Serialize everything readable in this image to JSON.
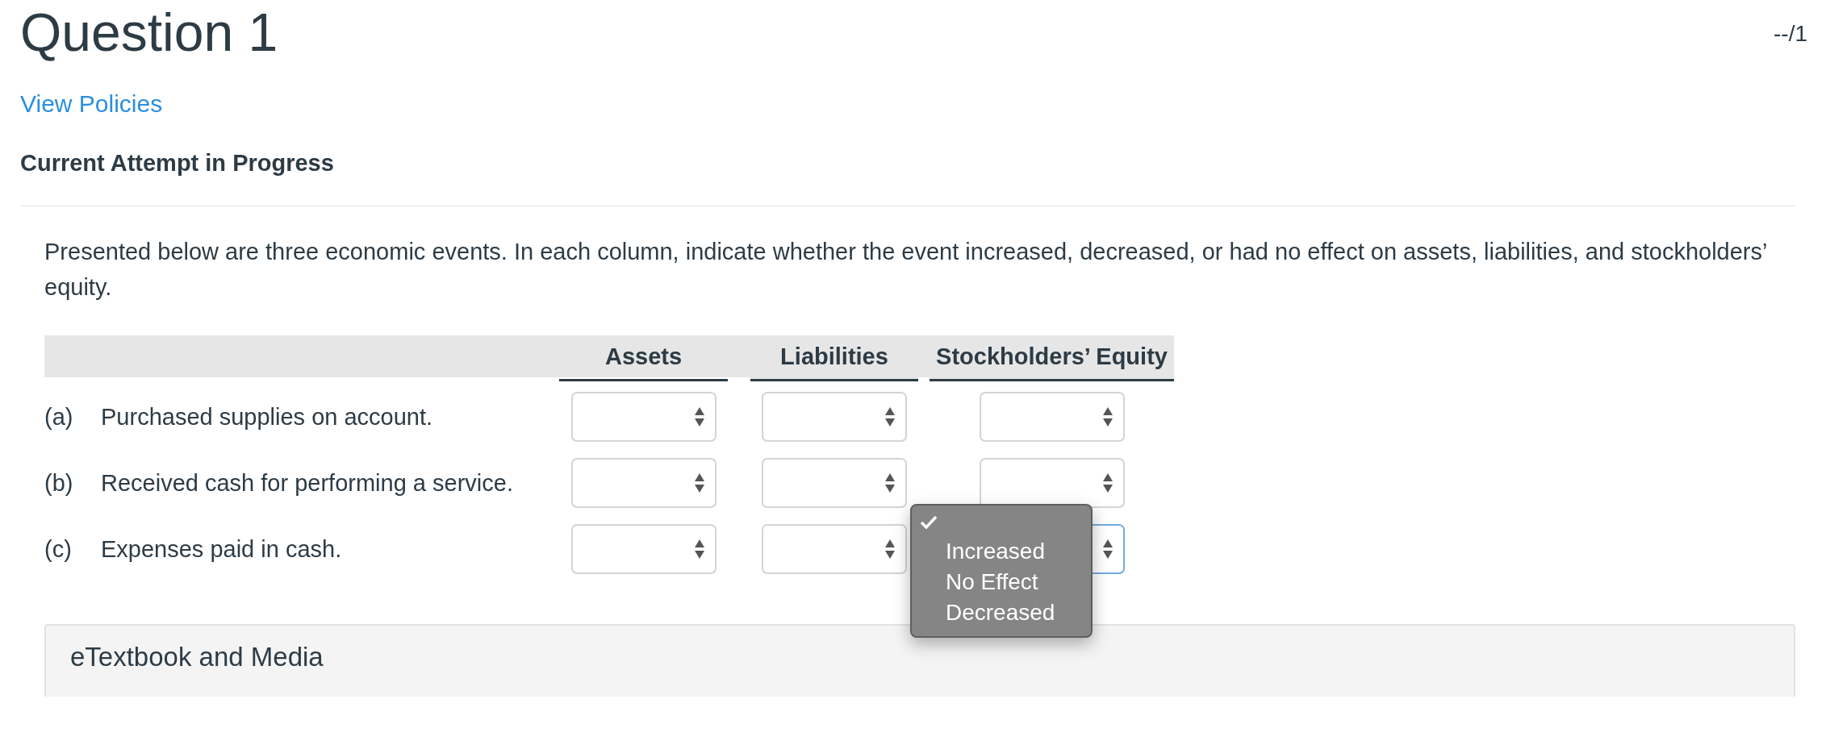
{
  "title": "Question 1",
  "score": "--/1",
  "policies_link": "View Policies",
  "status": "Current Attempt in Progress",
  "prompt": "Presented below are three economic events. In each column, indicate whether the event increased, decreased, or had no effect on assets, liabilities, and stockholders’ equity.",
  "table": {
    "columns": [
      "Assets",
      "Liabilities",
      "Stockholders’ Equity"
    ],
    "rows": [
      {
        "letter": "(a)",
        "text": "Purchased supplies on account.",
        "answers": [
          {
            "open": false
          },
          {
            "open": false
          },
          {
            "open": false
          }
        ]
      },
      {
        "letter": "(b)",
        "text": "Received cash for performing a service.",
        "answers": [
          {
            "open": false
          },
          {
            "open": false
          },
          {
            "open": false
          }
        ]
      },
      {
        "letter": "(c)",
        "text": "Expenses paid in cash.",
        "answers": [
          {
            "open": false
          },
          {
            "open": false
          },
          {
            "open": true
          }
        ]
      }
    ]
  },
  "dropdown": {
    "blank_option_selected": true,
    "options": [
      {
        "label": "Increased",
        "selected": false
      },
      {
        "label": "No Effect",
        "selected": false
      },
      {
        "label": "Decreased",
        "selected": false
      }
    ]
  },
  "panel": {
    "title": "eTextbook and Media"
  }
}
